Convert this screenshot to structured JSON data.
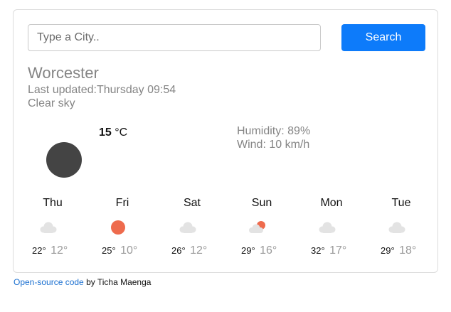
{
  "search": {
    "placeholder": "Type a City..",
    "value": "",
    "button_label": "Search"
  },
  "current": {
    "city": "Worcester",
    "updated_label": "Last updated:",
    "updated_time": "Thursday 09:54",
    "description": "Clear sky",
    "temperature": "15",
    "unit": "°C",
    "humidity_label": "Humidity:",
    "humidity": "89%",
    "wind_label": "Wind:",
    "wind": "10 km/h",
    "icon": "moon-dark-circle-icon"
  },
  "forecast": [
    {
      "day": "Thu",
      "max": "22°",
      "min": "12°",
      "icon": "cloud-icon"
    },
    {
      "day": "Fri",
      "max": "25°",
      "min": "10°",
      "icon": "sun-icon"
    },
    {
      "day": "Sat",
      "max": "26°",
      "min": "12°",
      "icon": "cloud-icon"
    },
    {
      "day": "Sun",
      "max": "29°",
      "min": "16°",
      "icon": "sun-behind-cloud-icon"
    },
    {
      "day": "Mon",
      "max": "32°",
      "min": "17°",
      "icon": "cloud-icon"
    },
    {
      "day": "Tue",
      "max": "29°",
      "min": "18°",
      "icon": "cloud-icon"
    }
  ],
  "footer": {
    "link_text": "Open-source code",
    "by_text": " by Ticha Maenga"
  },
  "colors": {
    "accent": "#0d7bfa",
    "sun": "#ee6b4d",
    "cloud": "#e3e3e3",
    "moon": "#444444",
    "muted_text": "#858585"
  }
}
